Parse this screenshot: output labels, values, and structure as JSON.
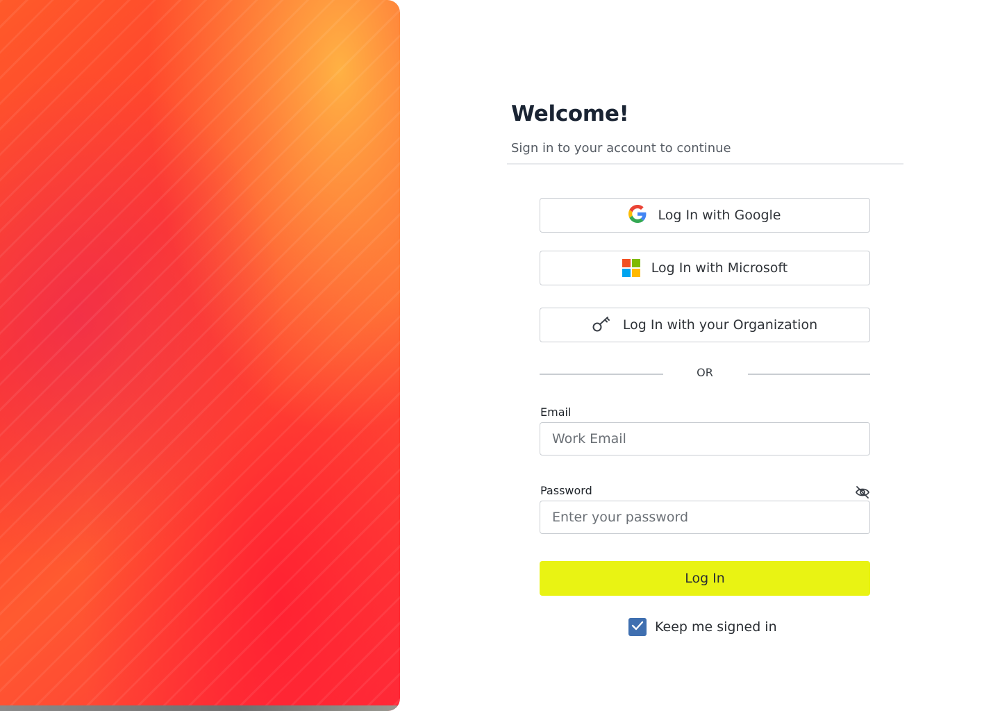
{
  "header": {
    "title": "Welcome!",
    "subtitle": "Sign in to your account to continue"
  },
  "sso": {
    "google_label": "Log In with Google",
    "microsoft_label": "Log In with Microsoft",
    "organization_label": "Log In with your Organization"
  },
  "divider": {
    "or_text": "OR"
  },
  "form": {
    "email": {
      "label": "Email",
      "placeholder": "Work Email",
      "value": ""
    },
    "password": {
      "label": "Password",
      "placeholder": "Enter your password",
      "value": "",
      "visibility_icon": "eye-off-icon"
    },
    "submit_label": "Log In",
    "keep_signed_in": {
      "label": "Keep me signed in",
      "checked": true
    }
  },
  "colors": {
    "submit_button": "#e9f313",
    "checkbox": "#3f6fb0",
    "title": "#1a2433"
  },
  "icons": {
    "google": "google-icon",
    "microsoft": "microsoft-icon",
    "organization": "key-icon",
    "checkbox": "checkmark-icon"
  }
}
